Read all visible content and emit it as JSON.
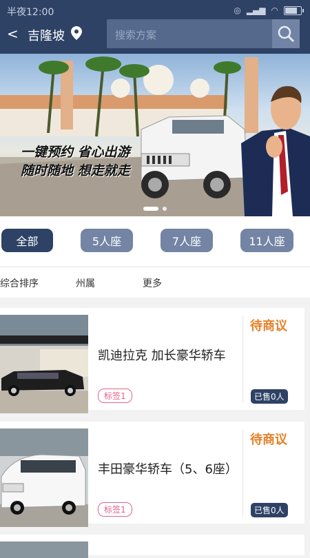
{
  "status": {
    "time": "半夜12:00"
  },
  "header": {
    "back_icon": "back-arrow-icon",
    "city": "吉隆坡",
    "search_placeholder": "搜索方案"
  },
  "banner": {
    "slogan_line1": "一键预约 省心出游",
    "slogan_line2": "随时随地 想走就走"
  },
  "filters": [
    {
      "label": "全部",
      "active": true
    },
    {
      "label": "5人座",
      "active": false
    },
    {
      "label": "7人座",
      "active": false
    },
    {
      "label": "11人座",
      "active": false
    }
  ],
  "sort": [
    "综合排序",
    "州属",
    "更多"
  ],
  "cars": [
    {
      "name": "凯迪拉克 加长豪华轿车",
      "tag": "标签1",
      "price": "待商议",
      "sold": "已售0人"
    },
    {
      "name": "丰田豪华轿车（5、6座）",
      "tag": "标签1",
      "price": "待商议",
      "sold": "已售0人"
    }
  ],
  "colors": {
    "primary": "#2e4266",
    "accent": "#e5822a",
    "tag": "#e0648a"
  }
}
